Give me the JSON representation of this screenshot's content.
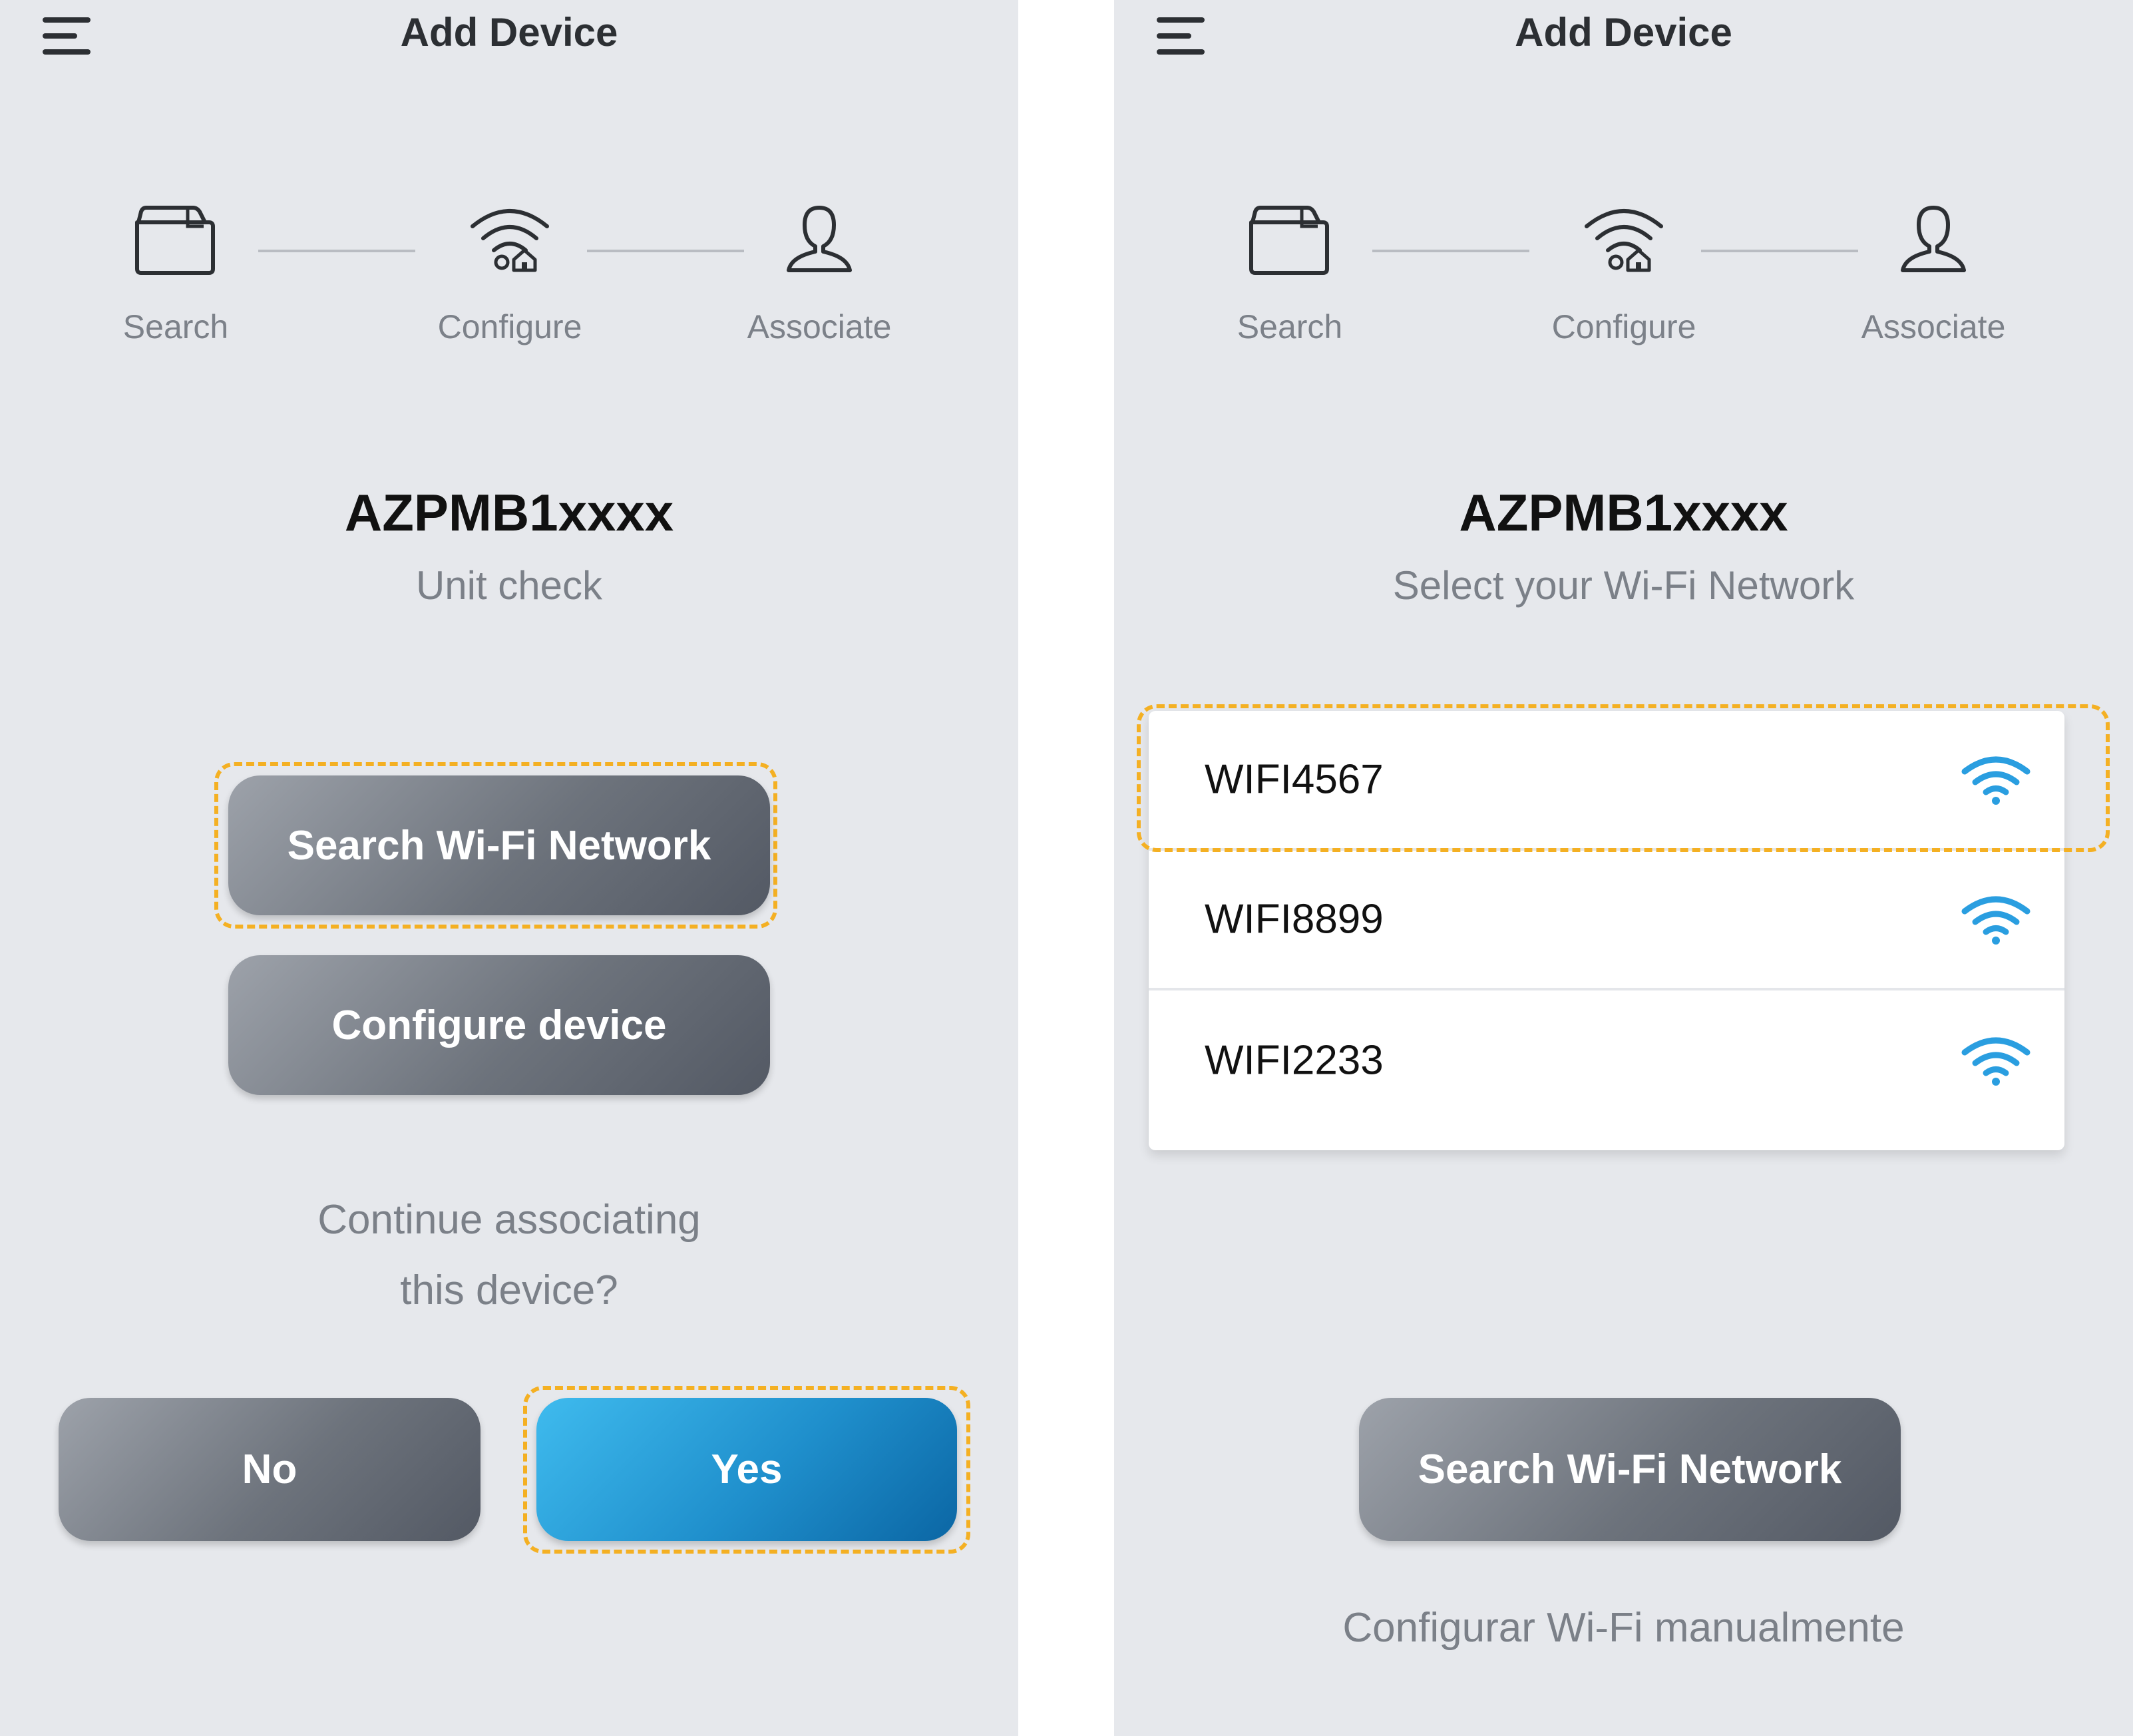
{
  "left_screen": {
    "title": "Add Device",
    "steps": [
      {
        "label": "Search",
        "icon": "folder-icon"
      },
      {
        "label": "Configure",
        "icon": "wifi-home-icon"
      },
      {
        "label": "Associate",
        "icon": "user-icon"
      }
    ],
    "device_name": "AZPMB1xxxx",
    "subtitle": "Unit check",
    "search_button": "Search Wi-Fi Network",
    "configure_button": "Configure device",
    "question_line1": "Continue associating",
    "question_line2": "this device?",
    "no_button": "No",
    "yes_button": "Yes"
  },
  "right_screen": {
    "title": "Add Device",
    "steps": [
      {
        "label": "Search",
        "icon": "folder-icon"
      },
      {
        "label": "Configure",
        "icon": "wifi-home-icon"
      },
      {
        "label": "Associate",
        "icon": "user-icon"
      }
    ],
    "device_name": "AZPMB1xxxx",
    "subtitle": "Select your Wi-Fi Network",
    "networks": [
      {
        "ssid": "WIFI4567"
      },
      {
        "ssid": "WIFI8899"
      },
      {
        "ssid": "WIFI2233"
      }
    ],
    "search_button": "Search Wi-Fi Network",
    "manual_link": "Configurar Wi-Fi manualmente"
  },
  "colors": {
    "screen_background": "#e6e8ec",
    "highlight_dash": "#f4b023",
    "primary_blue": "#1f8fcc",
    "wifi_icon": "#2a9ee0",
    "gray_button": "#6d737c"
  }
}
